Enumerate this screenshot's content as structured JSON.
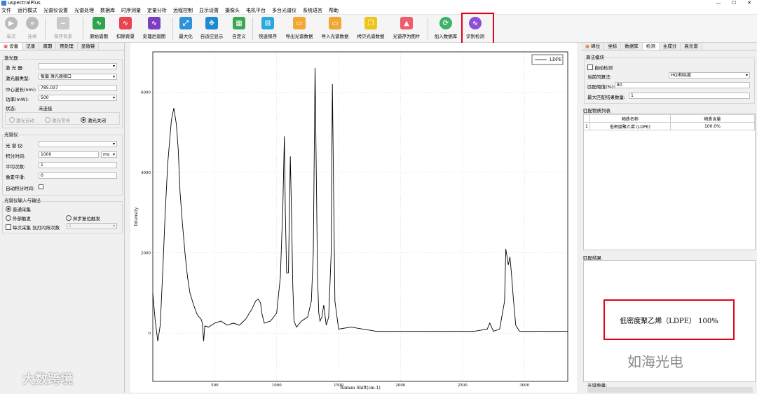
{
  "window": {
    "title": "uspectralPlus",
    "minimize": "—",
    "maximize": "☐",
    "close": "✕"
  },
  "menu": [
    "文件",
    "运行模式",
    "光谱仪设置",
    "光谱处理",
    "数据库",
    "时序测量",
    "定量分析",
    "远程控制",
    "显示设置",
    "摄像头",
    "电机平台",
    "多台光谱仪",
    "系统语言",
    "帮助"
  ],
  "toolbar": {
    "single": "单次",
    "continuous": "连续",
    "save_background": "保存背景",
    "raw_spectrum": "原始谱图",
    "subtract_background": "扣除背景",
    "processed_spectrum": "处理后谱图",
    "maximize": "最大化",
    "auto_fit": "自适应显示",
    "custom": "自定义",
    "quick_save": "快速保存",
    "export_data": "导出光谱数据",
    "import_data": "导入光谱数据",
    "copy_data": "拷贝光谱数据",
    "save_image": "光谱存为图片",
    "add_to_db": "加入数据库",
    "identify": "识别检测"
  },
  "left": {
    "tabs": [
      "设备",
      "记录",
      "周期",
      "预处理",
      "显微镜"
    ],
    "laser": {
      "group": "激光器",
      "laser_label": "激 光 器:",
      "type_label": "激光器类型:",
      "type_value": "板载 激光器接口",
      "wavelength_label": "中心波长(nm):",
      "wavelength_value": "785.037",
      "power_label": "功率(mW):",
      "power_value": "500",
      "status_label": "状态:",
      "status_value": "未连接",
      "radio_auto": "激光自动",
      "radio_on": "激光常亮",
      "radio_off": "激光关闭"
    },
    "spectrometer": {
      "group": "光谱仪",
      "spec_label": "光 谱 仪:",
      "integration_label": "积分时间:",
      "integration_value": "1000",
      "integration_unit": "ms",
      "average_label": "平均次数:",
      "average_value": "1",
      "smooth_label": "像素平滑:",
      "smooth_value": "0",
      "auto_int_label": "自动积分时间:"
    },
    "io": {
      "group": "光谱仪输入与输出",
      "normal": "普通采集",
      "external": "外部触发",
      "async": "异步复位触发",
      "flash_label": "每次采集 氙灯闪烁次数",
      "flash_value": "1"
    }
  },
  "chart_data": {
    "type": "line",
    "title": "",
    "xlabel": "Raman Shift(cm-1)",
    "ylabel": "Intensity",
    "xlim": [
      0,
      3350
    ],
    "ylim": [
      -1200,
      7000
    ],
    "xticks": [
      500,
      1000,
      1500,
      2000,
      2500,
      3000
    ],
    "yticks": [
      0,
      2000,
      4000,
      6000
    ],
    "grid": true,
    "legend": "top-right",
    "series": [
      {
        "name": "LDPE",
        "x": [
          0,
          20,
          40,
          60,
          80,
          100,
          120,
          150,
          170,
          190,
          205,
          220,
          240,
          260,
          280,
          300,
          330,
          360,
          390,
          400,
          410,
          420,
          450,
          500,
          550,
          600,
          650,
          700,
          750,
          800,
          830,
          850,
          870,
          880,
          900,
          950,
          1000,
          1030,
          1050,
          1062,
          1070,
          1080,
          1095,
          1110,
          1120,
          1130,
          1140,
          1160,
          1200,
          1250,
          1280,
          1296,
          1310,
          1330,
          1340,
          1350,
          1365,
          1380,
          1400,
          1420,
          1440,
          1450,
          1460,
          1470,
          1500,
          1600,
          1800,
          2000,
          2200,
          2400,
          2600,
          2700,
          2720,
          2750,
          2800,
          2840,
          2850,
          2870,
          2883,
          2895,
          2910,
          2930,
          2960,
          3000,
          3100,
          3200,
          3350
        ],
        "y": [
          1000,
          300,
          -200,
          200,
          1500,
          3000,
          4200,
          5300,
          5600,
          5200,
          4600,
          3500,
          2700,
          2000,
          1400,
          1000,
          700,
          450,
          350,
          250,
          -200,
          180,
          150,
          250,
          300,
          200,
          250,
          200,
          350,
          600,
          800,
          850,
          750,
          500,
          250,
          300,
          500,
          1400,
          3200,
          4900,
          3000,
          1500,
          1500,
          4400,
          3000,
          1200,
          300,
          150,
          300,
          400,
          800,
          2000,
          6600,
          1400,
          500,
          300,
          400,
          700,
          200,
          400,
          2000,
          6200,
          3500,
          800,
          100,
          150,
          50,
          50,
          50,
          50,
          50,
          100,
          250,
          50,
          100,
          800,
          2100,
          1700,
          1900,
          1500,
          900,
          200,
          50,
          50,
          50,
          50,
          50
        ]
      }
    ]
  },
  "right": {
    "tabs": [
      "峰位",
      "坐标",
      "数据库",
      "检测",
      "主成分",
      "高光谱"
    ],
    "algo": {
      "group": "算法模块",
      "auto_detect": "自动检测",
      "current_label": "当前的算法:",
      "current_value": "HQI相似度",
      "threshold_label": "匹配阈值(%):",
      "threshold_value": "80",
      "max_label": "最大匹配结果数量:",
      "max_value": "1"
    },
    "list_title": "匹配物质列表",
    "col_name": "物质名称",
    "col_content": "物质含量",
    "row_index": "1",
    "row_name": "低密度聚乙烯 (LDPE)",
    "row_content": "100.0%",
    "result_title": "匹配结果",
    "result_text": "低密度聚乙烯（LDPE） 100%",
    "quality_label": "光谱质量:"
  },
  "watermarks": {
    "wechat": "如海光电",
    "corner": "大数跨境"
  }
}
